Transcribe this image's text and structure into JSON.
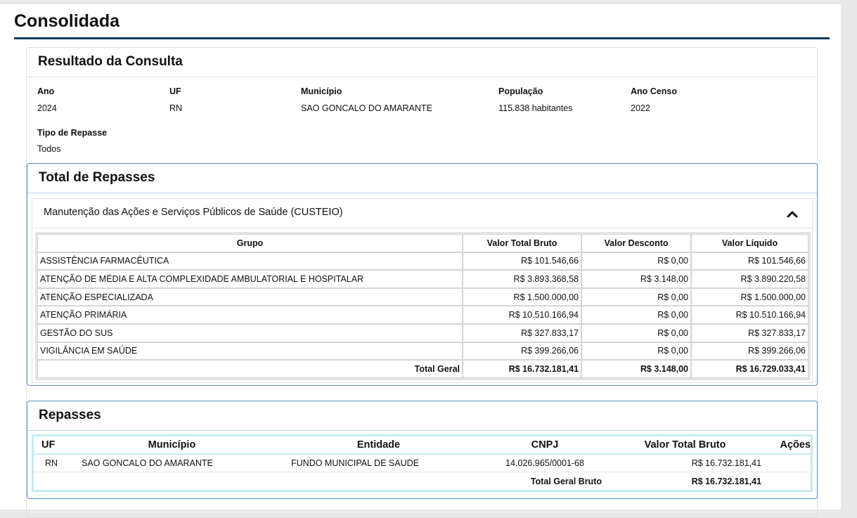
{
  "page": {
    "title": "Consolidada"
  },
  "result": {
    "title": "Resultado da Consulta",
    "fields": {
      "ano": {
        "label": "Ano",
        "value": "2024"
      },
      "uf": {
        "label": "UF",
        "value": "RN"
      },
      "municipio": {
        "label": "Município",
        "value": "SAO GONCALO DO AMARANTE"
      },
      "populacao": {
        "label": "População",
        "value": "115.838 habitantes"
      },
      "ano_censo": {
        "label": "Ano Censo",
        "value": "2022"
      },
      "tipo_repasse": {
        "label": "Tipo de Repasse",
        "value": "Todos"
      }
    }
  },
  "total_repasses": {
    "title": "Total de Repasses",
    "accordion_title": "Manutenção das Ações e Serviços Públicos de Saúde (CUSTEIO)",
    "chevron_icon": "chevron-up-icon",
    "headers": [
      "Grupo",
      "Valor Total Bruto",
      "Valor Desconto",
      "Valor Líquido"
    ],
    "rows": [
      [
        "ASSISTÊNCIA FARMACÊUTICA",
        "R$ 101.546,66",
        "R$ 0,00",
        "R$ 101.546,66"
      ],
      [
        "ATENÇÃO DE MÉDIA E ALTA COMPLEXIDADE AMBULATORIAL E HOSPITALAR",
        "R$ 3.893.368,58",
        "R$ 3.148,00",
        "R$ 3.890.220,58"
      ],
      [
        "ATENÇÃO ESPECIALIZADA",
        "R$ 1.500.000,00",
        "R$ 0,00",
        "R$ 1.500.000,00"
      ],
      [
        "ATENÇÃO PRIMÁRIA",
        "R$ 10.510.166,94",
        "R$ 0,00",
        "R$ 10.510.166,94"
      ],
      [
        "GESTÃO DO SUS",
        "R$ 327.833,17",
        "R$ 0,00",
        "R$ 327.833,17"
      ],
      [
        "VIGILÂNCIA EM SAÚDE",
        "R$ 399.266,06",
        "R$ 0,00",
        "R$ 399.266,06"
      ]
    ],
    "total": [
      "Total Geral",
      "R$ 16.732.181,41",
      "R$ 3.148,00",
      "R$ 16.729.033,41"
    ]
  },
  "repasses": {
    "title": "Repasses",
    "headers": [
      "UF",
      "Município",
      "Entidade",
      "CNPJ",
      "Valor Total Bruto",
      "Ações"
    ],
    "rows": [
      [
        "RN",
        "SAO GONCALO DO AMARANTE",
        "FUNDO MUNICIPAL DE SAUDE",
        "14.026.965/0001-68",
        "R$ 16.732.181,41",
        ""
      ]
    ],
    "total_label": "Total Geral Bruto",
    "total_value": "R$ 16.732.181,41"
  }
}
